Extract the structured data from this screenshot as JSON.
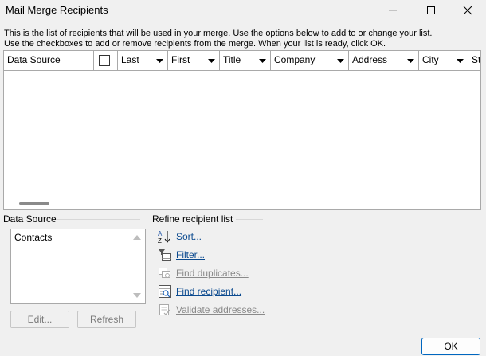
{
  "window": {
    "title": "Mail Merge Recipients",
    "minimize_icon": "minimize-icon",
    "maximize_icon": "maximize-icon",
    "close_icon": "close-icon"
  },
  "intro": {
    "line1": "This is the list of recipients that will be used in your merge.  Use the options below to add to or change your list.",
    "line2": "Use the checkboxes to add or remove recipients from the merge.  When your list is ready, click OK."
  },
  "grid": {
    "columns": [
      "Data Source",
      "",
      "Last",
      "First",
      "Title",
      "Company",
      "Address",
      "City",
      "Sta"
    ],
    "rows": []
  },
  "data_source": {
    "label": "Data Source",
    "items": [
      "Contacts"
    ],
    "edit_label": "Edit...",
    "refresh_label": "Refresh"
  },
  "refine": {
    "label": "Refine recipient list",
    "items": [
      {
        "label": "Sort...",
        "icon": "sort-az-icon",
        "enabled": true
      },
      {
        "label": "Filter...",
        "icon": "filter-icon",
        "enabled": true
      },
      {
        "label": "Find duplicates...",
        "icon": "find-duplicates-icon",
        "enabled": false
      },
      {
        "label": "Find recipient...",
        "icon": "find-recipient-icon",
        "enabled": true
      },
      {
        "label": "Validate addresses...",
        "icon": "validate-addresses-icon",
        "enabled": false
      }
    ]
  },
  "ok_label": "OK",
  "colors": {
    "link": "#0b4a8f",
    "disabled": "#8a8a8a",
    "accent_border": "#0067c0"
  }
}
